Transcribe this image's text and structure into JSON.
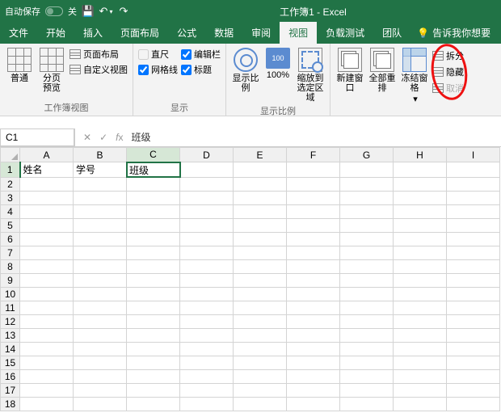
{
  "title": {
    "autosave": "自动保存",
    "autosave_state": "关",
    "doc": "工作簿1 - Excel"
  },
  "tabs": [
    "文件",
    "开始",
    "插入",
    "页面布局",
    "公式",
    "数据",
    "审阅",
    "视图",
    "负载测试",
    "团队"
  ],
  "active_tab": "视图",
  "tell_me": "告诉我你想要",
  "ribbon": {
    "views": {
      "normal": "普通",
      "pagebreak": "分页\n预览",
      "pagelayout": "页面布局",
      "custom": "自定义视图",
      "group": "工作簿视图"
    },
    "show": {
      "ruler": "直尺",
      "formula_bar": "编辑栏",
      "gridlines": "网格线",
      "headings": "标题",
      "group": "显示"
    },
    "zoom": {
      "zoom": "显示比例",
      "to100": "100%",
      "tosel": "缩放到\n选定区域",
      "group": "显示比例"
    },
    "window": {
      "newwin": "新建窗口",
      "arrange": "全部重排",
      "freeze": "冻结窗格",
      "split": "拆分",
      "hide": "隐藏",
      "unhide": "取消"
    }
  },
  "namebox": "C1",
  "formula_value": "班级",
  "columns": [
    "A",
    "B",
    "C",
    "D",
    "E",
    "F",
    "G",
    "H",
    "I"
  ],
  "selected_col": "C",
  "selected_row": 1,
  "cells": {
    "A1": "姓名",
    "B1": "学号",
    "C1": "班级"
  },
  "row_count": 18
}
